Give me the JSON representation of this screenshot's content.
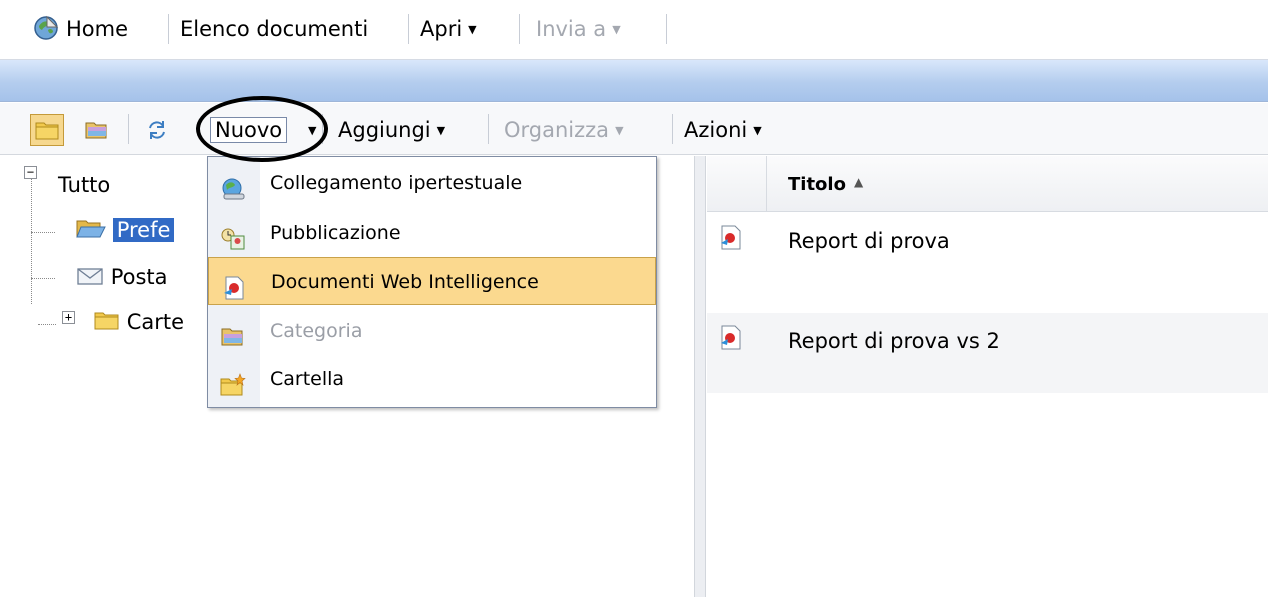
{
  "topbar": {
    "home": "Home",
    "document_list": "Elenco documenti",
    "open": "Apri",
    "send_to": "Invia a"
  },
  "toolbar": {
    "new": "Nuovo",
    "add": "Aggiungi",
    "organize": "Organizza",
    "actions": "Azioni"
  },
  "tree": {
    "root": "Tutto",
    "items": [
      "Prefe",
      "Posta",
      "Carte"
    ]
  },
  "list": {
    "column_title": "Titolo",
    "rows": [
      {
        "title": "Report di prova",
        "icon": "webi-document-icon"
      },
      {
        "title": "Report di prova vs 2",
        "icon": "webi-document-icon"
      }
    ]
  },
  "new_menu": {
    "items": [
      {
        "label": "Collegamento ipertestuale",
        "icon": "hyperlink-icon",
        "state": "normal"
      },
      {
        "label": "Pubblicazione",
        "icon": "publication-icon",
        "state": "normal"
      },
      {
        "label": "Documenti Web Intelligence",
        "icon": "webi-document-icon",
        "state": "highlighted"
      },
      {
        "label": "Categoria",
        "icon": "category-icon",
        "state": "disabled"
      },
      {
        "label": "Cartella",
        "icon": "new-folder-icon",
        "state": "normal"
      }
    ]
  },
  "colors": {
    "selection": "#316ac5",
    "menu_highlight": "#fbd98f",
    "band": "#b4cdee"
  }
}
